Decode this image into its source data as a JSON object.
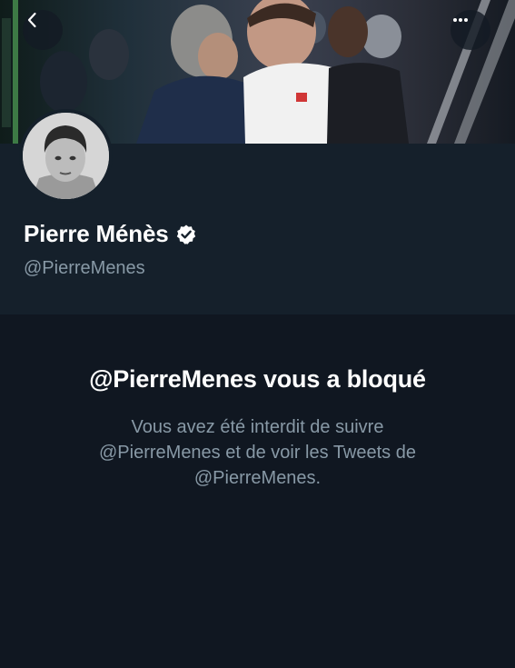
{
  "header": {
    "back_icon": "chevron-left-icon",
    "more_icon": "more-dots-icon"
  },
  "profile": {
    "display_name": "Pierre Ménès",
    "handle": "@PierreMenes",
    "verified_icon": "verified-badge-icon",
    "avatar": "profile-avatar"
  },
  "blocked": {
    "title": "@PierreMenes vous a bloqué",
    "message_lines": [
      "Vous avez été interdit de suivre",
      "@PierreMenes et de voir les Tweets de",
      "@PierreMenes."
    ]
  },
  "colors": {
    "background": "#15202b",
    "blocked_background": "#101721",
    "secondary_text": "#8899a6",
    "primary_text": "#ffffff"
  }
}
